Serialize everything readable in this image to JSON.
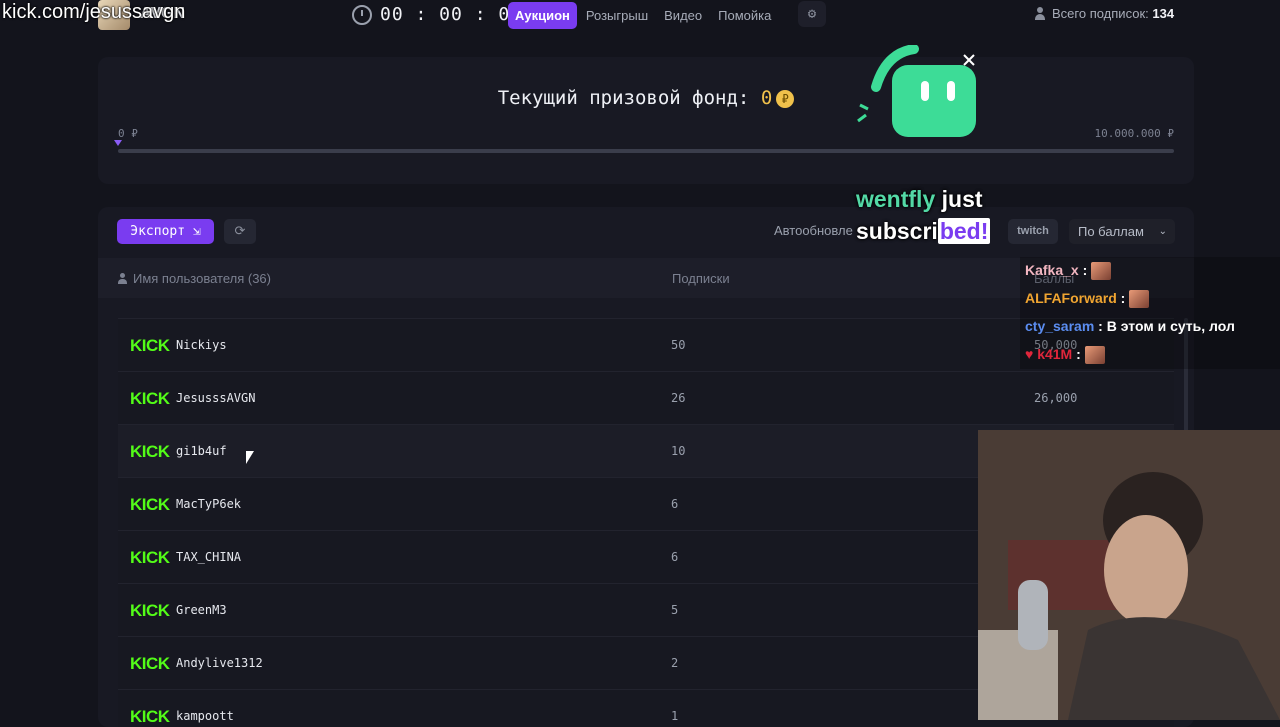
{
  "header": {
    "url_overlay": "kick.com/jesussavgn",
    "channel_name": "AVGN",
    "timer": "00 : 00 : 00",
    "nav": [
      {
        "label": "Аукцион",
        "active": true
      },
      {
        "label": "Розыгрыш",
        "active": false
      },
      {
        "label": "Видео",
        "active": false
      },
      {
        "label": "Помойка",
        "active": false
      }
    ],
    "subs_label": "Всего подписок:",
    "subs_total": "134"
  },
  "prize": {
    "title": "Текущий призовой фонд:",
    "value": "0",
    "coin_symbol": "₽",
    "min_label": "0 ₽",
    "max_label": "10.000.000 ₽",
    "progress": 0
  },
  "toolbar": {
    "export_label": "Экспорт",
    "auto_refresh_label": "Автообновле",
    "twitch_label": "twitch",
    "sort_value": "По баллам"
  },
  "table": {
    "col_user": "Имя пользователя (36)",
    "col_subs": "Подписки",
    "col_points": "Баллы",
    "rows": [
      {
        "platform": "KICK",
        "user": "Nickiys",
        "subs": "50",
        "points": "50,000"
      },
      {
        "platform": "KICK",
        "user": "JesusssAVGN",
        "subs": "26",
        "points": "26,000"
      },
      {
        "platform": "KICK",
        "user": "gi1b4uf",
        "subs": "10",
        "points": ""
      },
      {
        "platform": "KICK",
        "user": "MacTyP6ek",
        "subs": "6",
        "points": ""
      },
      {
        "platform": "KICK",
        "user": "TAX_CHINA",
        "subs": "6",
        "points": ""
      },
      {
        "platform": "KICK",
        "user": "GreenM3",
        "subs": "5",
        "points": ""
      },
      {
        "platform": "KICK",
        "user": "Andylive1312",
        "subs": "2",
        "points": ""
      },
      {
        "platform": "KICK",
        "user": "kampoott",
        "subs": "1",
        "points": ""
      }
    ]
  },
  "overlay": {
    "alert_name": "wentfly",
    "alert_just": "just",
    "alert_sub_a": "subscri",
    "alert_sub_b": "bed!",
    "chat": [
      {
        "user": "Kafka_x",
        "color": "#f2b6c0",
        "text": ""
      },
      {
        "user": "ALFAForward",
        "color": "#f0a531",
        "text": ""
      },
      {
        "user": "cty_saram",
        "color": "#5b8df0",
        "text": "В этом и суть, лол"
      },
      {
        "user": "k41M",
        "color": "#e0263b",
        "text": ""
      }
    ]
  },
  "colors": {
    "accent": "#7a3cf0",
    "kick_green": "#53fc18",
    "coin": "#f0c14b",
    "mascot": "#3ddc97"
  }
}
